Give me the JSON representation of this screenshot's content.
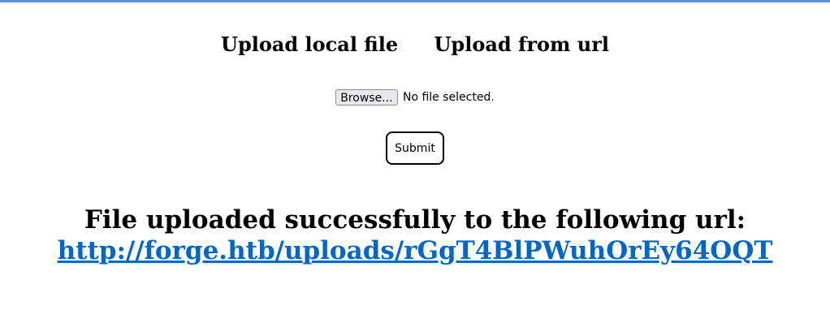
{
  "tabs": [
    {
      "label": "Upload local file"
    },
    {
      "label": "Upload from url"
    }
  ],
  "file_input": {
    "button_label": "Browse...",
    "status": "No file selected."
  },
  "submit": {
    "label": "Submit"
  },
  "result": {
    "message": "File uploaded successfully to the following url:",
    "url": "http://forge.htb/uploads/rGgT4BlPWuhOrEy64OQT"
  },
  "colors": {
    "accent_bar": "#5a8ee0",
    "link": "#0066cc"
  }
}
